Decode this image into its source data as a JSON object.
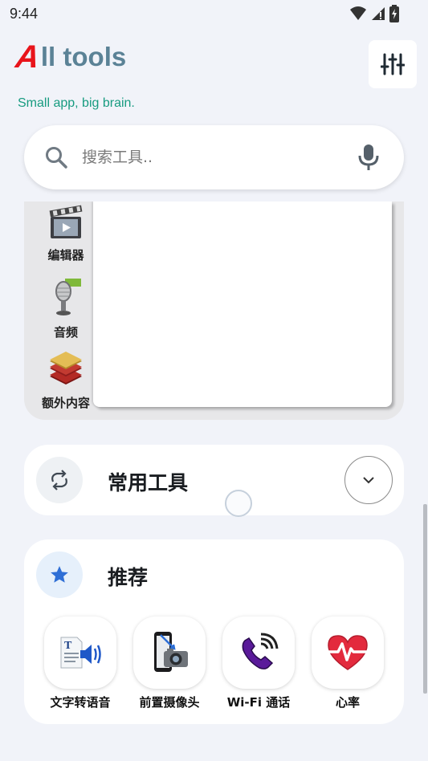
{
  "status": {
    "time": "9:44"
  },
  "header": {
    "logo_letter": "A",
    "title_rest": "ll tools",
    "tagline": "Small app, big brain.",
    "accent": "#e8141b",
    "title_color": "#5b8296"
  },
  "search": {
    "placeholder": "搜索工具.."
  },
  "categories": [
    {
      "label": "编辑器",
      "icon": "video-editor-icon"
    },
    {
      "label": "音频",
      "icon": "microphone-icon"
    },
    {
      "label": "额外内容",
      "icon": "layers-icon"
    }
  ],
  "common_tools": {
    "title": "常用工具"
  },
  "recommended": {
    "title": "推荐",
    "tools": [
      {
        "label": "文字转语音",
        "icon": "text-to-speech-icon"
      },
      {
        "label": "前置摄像头",
        "icon": "front-camera-icon"
      },
      {
        "label": "Wi-Fi 通话",
        "icon": "wifi-call-icon"
      },
      {
        "label": "心率",
        "icon": "heart-rate-icon"
      }
    ]
  }
}
